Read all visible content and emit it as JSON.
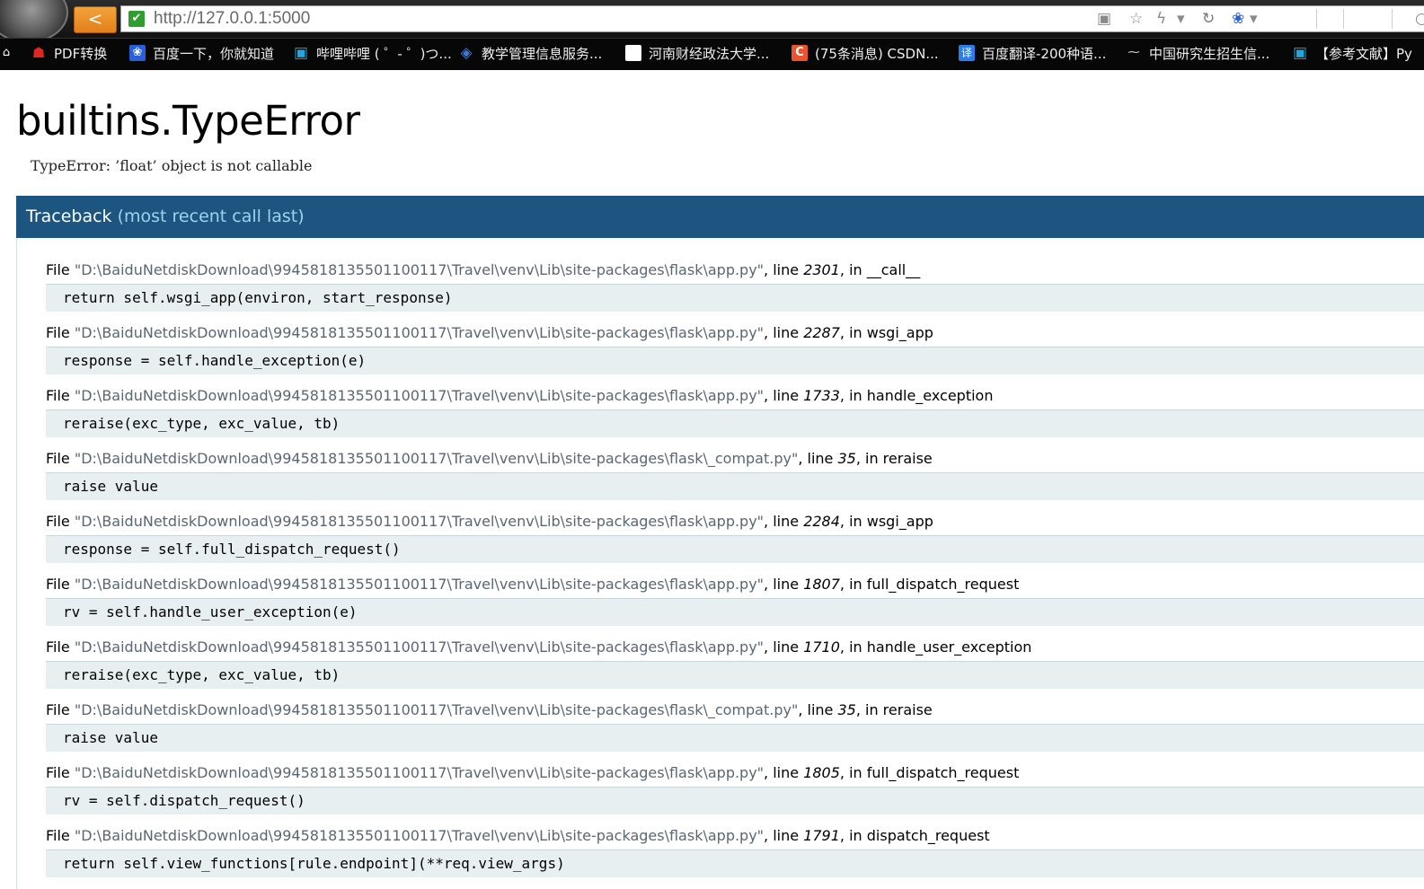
{
  "browser": {
    "url": "http://127.0.0.1:5000",
    "back_glyph": "<",
    "secure_glyph": "✔",
    "address_icons": [
      {
        "name": "image-icon",
        "glyph": "▣"
      },
      {
        "name": "star-icon",
        "glyph": "☆"
      },
      {
        "name": "lightning-icon",
        "glyph": "ϟ"
      },
      {
        "name": "dropdown-icon",
        "glyph": "▾"
      },
      {
        "name": "refresh-icon",
        "glyph": "↻"
      },
      {
        "name": "paw-icon",
        "glyph": "❀"
      },
      {
        "name": "search-dropdown-icon",
        "glyph": "▾"
      },
      {
        "name": "search-icon",
        "glyph": "○"
      }
    ]
  },
  "bookmarks": [
    {
      "icon": "home-icon",
      "glyph": "⌂",
      "color": "#000000",
      "label": ""
    },
    {
      "icon": "pdf-icon",
      "glyph": "☗",
      "color": "#e0261e",
      "label": "PDF转换"
    },
    {
      "icon": "baidu-paw-icon",
      "glyph": "❀",
      "color": "#2a5fd8",
      "label": "百度一下，你就知道"
    },
    {
      "icon": "bilibili-icon",
      "glyph": "▣",
      "color": "#23a6e0",
      "label": "哔哩哔哩 ( ゜- ゜)つ..."
    },
    {
      "icon": "layers-icon",
      "glyph": "◈",
      "color": "#3a7bd5",
      "label": "教学管理信息服务..."
    },
    {
      "icon": "blank-page-icon",
      "glyph": "",
      "color": "#ffffff",
      "label": "河南财经政法大学..."
    },
    {
      "icon": "csdn-icon",
      "glyph": "C",
      "color": "#e9542f",
      "label": "(75条消息) CSDN..."
    },
    {
      "icon": "translate-icon",
      "glyph": "译",
      "color": "#2b7de9",
      "label": "百度翻译-200种语..."
    },
    {
      "icon": "link-icon",
      "glyph": "⁓",
      "color": "#cccccc",
      "label": "中国研究生招生信..."
    },
    {
      "icon": "bilibili-icon",
      "glyph": "▣",
      "color": "#23a6e0",
      "label": "【参考文献】Py"
    }
  ],
  "page": {
    "title": "builtins.TypeError",
    "message": "TypeError: ’float’ object is not callable",
    "traceback_title": "Traceback",
    "traceback_subtitle": "(most recent call last)"
  },
  "frames": [
    {
      "file": "\"D:\\BaiduNetdiskDownload\\9945818135501100117\\Travel\\venv\\Lib\\site-packages\\flask\\app.py\"",
      "line": "2301",
      "func": "__call__",
      "code": "return self.wsgi_app(environ, start_response)"
    },
    {
      "file": "\"D:\\BaiduNetdiskDownload\\9945818135501100117\\Travel\\venv\\Lib\\site-packages\\flask\\app.py\"",
      "line": "2287",
      "func": "wsgi_app",
      "code": "response = self.handle_exception(e)"
    },
    {
      "file": "\"D:\\BaiduNetdiskDownload\\9945818135501100117\\Travel\\venv\\Lib\\site-packages\\flask\\app.py\"",
      "line": "1733",
      "func": "handle_exception",
      "code": "reraise(exc_type, exc_value, tb)"
    },
    {
      "file": "\"D:\\BaiduNetdiskDownload\\9945818135501100117\\Travel\\venv\\Lib\\site-packages\\flask\\_compat.py\"",
      "line": "35",
      "func": "reraise",
      "code": "raise value"
    },
    {
      "file": "\"D:\\BaiduNetdiskDownload\\9945818135501100117\\Travel\\venv\\Lib\\site-packages\\flask\\app.py\"",
      "line": "2284",
      "func": "wsgi_app",
      "code": "response = self.full_dispatch_request()"
    },
    {
      "file": "\"D:\\BaiduNetdiskDownload\\9945818135501100117\\Travel\\venv\\Lib\\site-packages\\flask\\app.py\"",
      "line": "1807",
      "func": "full_dispatch_request",
      "code": "rv = self.handle_user_exception(e)"
    },
    {
      "file": "\"D:\\BaiduNetdiskDownload\\9945818135501100117\\Travel\\venv\\Lib\\site-packages\\flask\\app.py\"",
      "line": "1710",
      "func": "handle_user_exception",
      "code": "reraise(exc_type, exc_value, tb)"
    },
    {
      "file": "\"D:\\BaiduNetdiskDownload\\9945818135501100117\\Travel\\venv\\Lib\\site-packages\\flask\\_compat.py\"",
      "line": "35",
      "func": "reraise",
      "code": "raise value"
    },
    {
      "file": "\"D:\\BaiduNetdiskDownload\\9945818135501100117\\Travel\\venv\\Lib\\site-packages\\flask\\app.py\"",
      "line": "1805",
      "func": "full_dispatch_request",
      "code": "rv = self.dispatch_request()"
    },
    {
      "file": "\"D:\\BaiduNetdiskDownload\\9945818135501100117\\Travel\\venv\\Lib\\site-packages\\flask\\app.py\"",
      "line": "1791",
      "func": "dispatch_request",
      "code": "return self.view_functions[rule.endpoint](**req.view_args)"
    }
  ],
  "labels": {
    "file_prefix": "File ",
    "line_word": ", line ",
    "in_word": ", in "
  },
  "colors": {
    "traceback_header_bg": "#1c5580",
    "traceback_subtitle": "#9cd3ef",
    "code_bg": "#e8eff0",
    "back_button": "#e3801a"
  }
}
